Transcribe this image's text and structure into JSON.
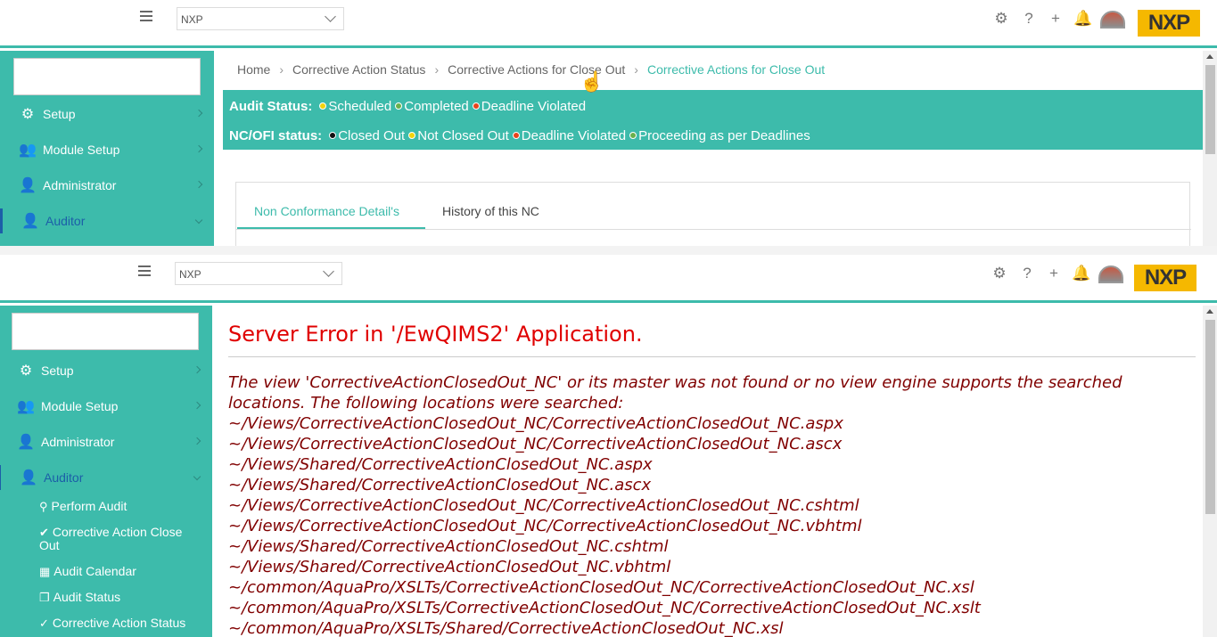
{
  "org_select": {
    "value": "NXP"
  },
  "logo": {
    "text": "NXP"
  },
  "toolbar": {
    "icons": [
      "gear-icon",
      "help-icon",
      "plus-icon",
      "bell-icon",
      "avatar",
      "nxp-logo"
    ]
  },
  "sidebar": {
    "items": [
      {
        "label": "Setup",
        "icon": "gear-icon"
      },
      {
        "label": "Module Setup",
        "icon": "users-gear-icon"
      },
      {
        "label": "Administrator",
        "icon": "user-gear-icon"
      },
      {
        "label": "Auditor",
        "icon": "user-check-icon"
      }
    ],
    "auditor_subitems": [
      {
        "label": "Perform Audit",
        "icon": "network-icon"
      },
      {
        "label": "Corrective Action Close Out",
        "icon": "check-circle-icon"
      },
      {
        "label": "Audit Calendar",
        "icon": "calendar-check-icon"
      },
      {
        "label": "Audit Status",
        "icon": "clone-icon"
      },
      {
        "label": "Corrective Action Status",
        "icon": "check-icon"
      }
    ]
  },
  "breadcrumb": {
    "items": [
      "Home",
      "Corrective Action Status",
      "Corrective Actions for Close Out"
    ],
    "current": "Corrective Actions for Close Out"
  },
  "audit_status": {
    "label": "Audit Status:",
    "entries": [
      {
        "text": "Scheduled",
        "color": "#f2d30b"
      },
      {
        "text": "Completed",
        "color": "#6ab04c"
      },
      {
        "text": "Deadline Violated",
        "color": "#e8431c"
      }
    ]
  },
  "nc_status": {
    "label": "NC/OFI status:",
    "entries": [
      {
        "text": "Closed Out",
        "color": "#111111"
      },
      {
        "text": "Not Closed Out",
        "color": "#f2d30b"
      },
      {
        "text": "Deadline Violated",
        "color": "#e8431c"
      },
      {
        "text": "Proceeding as per Deadlines",
        "color": "#6ab04c"
      }
    ]
  },
  "tabs": [
    {
      "label": "Non Conformance Detail's",
      "active": true
    },
    {
      "label": "History of this NC",
      "active": false
    }
  ],
  "error": {
    "title": "Server Error in '/EwQIMS2' Application.",
    "message_lines": [
      "The view 'CorrectiveActionClosedOut_NC' or its master was not found or no view engine supports the searched",
      "locations. The following locations were searched:",
      "~/Views/CorrectiveActionClosedOut_NC/CorrectiveActionClosedOut_NC.aspx",
      "~/Views/CorrectiveActionClosedOut_NC/CorrectiveActionClosedOut_NC.ascx",
      "~/Views/Shared/CorrectiveActionClosedOut_NC.aspx",
      "~/Views/Shared/CorrectiveActionClosedOut_NC.ascx",
      "~/Views/CorrectiveActionClosedOut_NC/CorrectiveActionClosedOut_NC.cshtml",
      "~/Views/CorrectiveActionClosedOut_NC/CorrectiveActionClosedOut_NC.vbhtml",
      "~/Views/Shared/CorrectiveActionClosedOut_NC.cshtml",
      "~/Views/Shared/CorrectiveActionClosedOut_NC.vbhtml",
      "~/common/AquaPro/XSLTs/CorrectiveActionClosedOut_NC/CorrectiveActionClosedOut_NC.xsl",
      "~/common/AquaPro/XSLTs/CorrectiveActionClosedOut_NC/CorrectiveActionClosedOut_NC.xslt",
      "~/common/AquaPro/XSLTs/Shared/CorrectiveActionClosedOut_NC.xsl"
    ]
  }
}
